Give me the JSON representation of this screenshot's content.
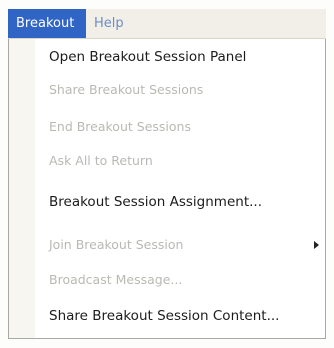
{
  "menubar": {
    "items": [
      {
        "label": "Breakout",
        "active": true
      },
      {
        "label": "Help",
        "active": false
      }
    ]
  },
  "menu": {
    "items": [
      {
        "label": "Open Breakout Session Panel",
        "enabled": true,
        "submenu": false
      },
      {
        "label": "Share Breakout Sessions",
        "enabled": false,
        "submenu": false
      },
      {
        "label": "End Breakout Sessions",
        "enabled": false,
        "submenu": false
      },
      {
        "label": "Ask All to Return",
        "enabled": false,
        "submenu": false
      },
      {
        "label": "Breakout Session Assignment...",
        "enabled": true,
        "submenu": false
      },
      {
        "label": "Join Breakout Session",
        "enabled": false,
        "submenu": true
      },
      {
        "label": "Broadcast Message...",
        "enabled": false,
        "submenu": false
      },
      {
        "label": "Share Breakout Session Content...",
        "enabled": true,
        "submenu": false
      }
    ]
  },
  "colors": {
    "menubar_active_bg": "#3165c5",
    "menubar_inactive_text": "#6c8ec4",
    "enabled_text": "#1c1c1c",
    "disabled_text": "#b9b9b4"
  }
}
